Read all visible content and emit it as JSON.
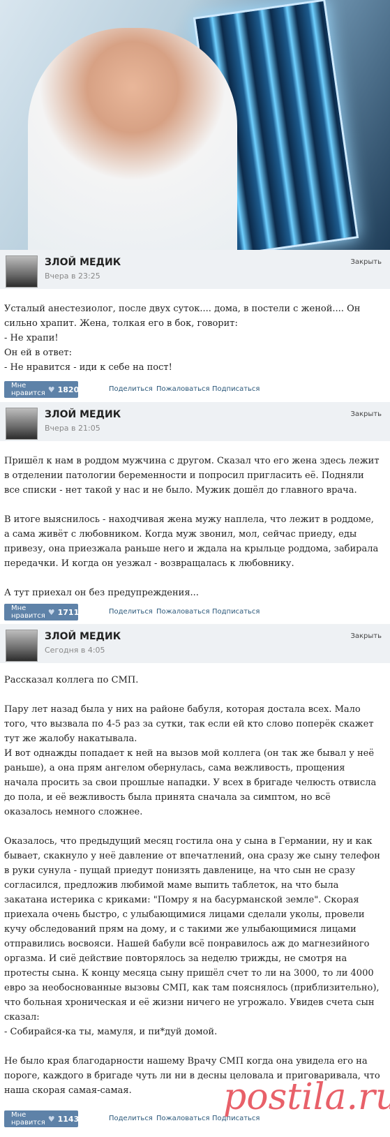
{
  "posts": [
    {
      "author": "ЗЛОЙ МЕДИК",
      "time": "Вчера в 23:25",
      "close_label": "Закрыть",
      "paragraphs": [
        "Усталый анестезиолог, после двух суток.... дома, в постели с женой.... Он сильно храпит. Жена, толкая его в бок, говорит:\n- Не храпи!\nОн ей в ответ:\n- Не нравится - иди к себе на пост!"
      ],
      "like_label": "Мне нравится",
      "like_count": "1820",
      "share_label": "Поделиться",
      "report_label": "Пожаловаться",
      "subscribe_label": "Подписаться"
    },
    {
      "author": "ЗЛОЙ МЕДИК",
      "time": "Вчера в 21:05",
      "close_label": "Закрыть",
      "paragraphs": [
        "Пришёл к нам в роддом мужчина с другом. Сказал что его жена здесь лежит в отделении патологии беременности и попросил пригласить её. Подняли все списки - нет такой у нас и не было. Мужик дошёл до главного врача.",
        "В итоге выяснилось - находчивая жена мужу наплела, что лежит в роддоме, а сама живёт с любовником. Когда муж звонил, мол, сейчас приеду, еды привезу, она приезжала раньше него и ждала на крыльце роддома, забирала передачки. И когда он уезжал - возвращалась к любовнику.",
        "А тут приехал он без предупреждения..."
      ],
      "like_label": "Мне нравится",
      "like_count": "1711",
      "share_label": "Поделиться",
      "report_label": "Пожаловаться",
      "subscribe_label": "Подписаться"
    },
    {
      "author": "ЗЛОЙ МЕДИК",
      "time": "Сегодня в 4:05",
      "close_label": "Закрыть",
      "paragraphs": [
        "Рассказал коллега по СМП.",
        "Пару лет назад была у них на районе бабуля, которая достала всех. Мало того, что вызвала по 4-5 раз за сутки, так если ей кто слово поперёк скажет тут же жалобу накатывала.\nИ вот однажды попадает к ней на вызов мой коллега (он так же бывал у неё раньше), а она прям ангелом обернулась, сама вежливость, прощения начала просить за свои прошлые нападки. У всех в бригаде челюсть отвисла до пола, и её вежливость была принята сначала за симптом, но всё оказалось немного сложнее.",
        "Оказалось, что предыдущий месяц гостила она у сына в Германии, ну и как бывает, скакнуло у неё давление от впечатлений, она сразу же сыну телефон в руки сунула - пущай приедут понизять давленице, на что сын не сразу согласился, предложив любимой маме выпить таблеток, на что была закатана истерика с криками: \"Помру я на басурманской земле\". Скорая приехала очень быстро, с улыбающимися лицами сделали уколы, провели кучу обследований прям на дому, и с такими же улыбающимися лицами отправились восвояси. Нашей бабули всё понравилось аж до магнезийного оргазма. И сиё действие повторялось за неделю трижды, не смотря на протесты сына. К концу месяца сыну пришёл счет то ли на 3000, то ли 4000 евро за необоснованные вызовы СМП, как там пояснялось (приблизительно), что больная хроническая и её жизни ничего не угрожало. Увидев счета сын сказал:\n- Собирайся-ка ты, мамуля, и пи*дуй домой.",
        "Не было края благодарности нашему Врачу СМП когда она увидела его на пороге, каждого в бригаде чуть ли ни в десны целовала и приговаривала, что наша скорая самая-самая."
      ],
      "like_label": "Мне нравится",
      "like_count": "1143",
      "share_label": "Поделиться",
      "report_label": "Пожаловаться",
      "subscribe_label": "Подписаться"
    }
  ],
  "watermark": "postila.ru",
  "icons": {
    "like": "heart-icon"
  },
  "colors": {
    "like_button": "#5e82a8",
    "link": "#2b587a",
    "header_bg": "#eef1f4",
    "watermark": "#e5454f"
  }
}
